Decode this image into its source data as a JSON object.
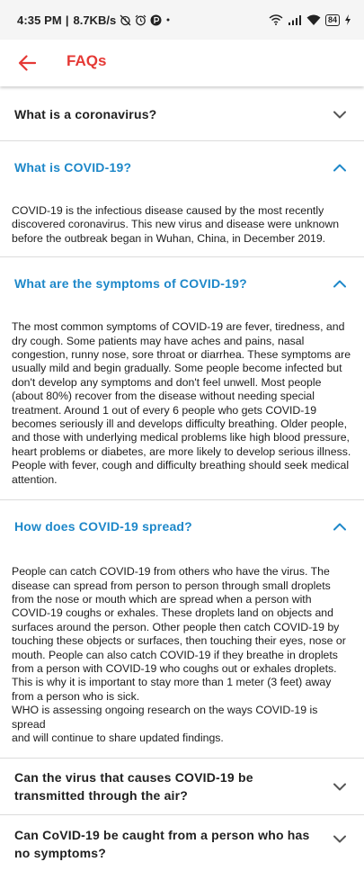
{
  "status_bar": {
    "time": "4:35 PM",
    "speed": "8.7KB/s",
    "battery": "84"
  },
  "app_bar": {
    "title": "FAQs"
  },
  "colors": {
    "accent": "#e53935",
    "expanded_question": "#1e88c9"
  },
  "faqs": [
    {
      "question": "What is a coronavirus?",
      "expanded": false,
      "answer": ""
    },
    {
      "question": "What is COVID-19?",
      "expanded": true,
      "answer": "COVID-19 is the infectious disease caused by the most recently\ndiscovered coronavirus. This new virus and disease were unknown\nbefore the outbreak began in Wuhan, China, in December 2019."
    },
    {
      "question": "What are the symptoms of COVID-19?",
      "expanded": true,
      "answer": "The most common symptoms of COVID-19 are fever, tiredness, and\ndry cough. Some patients may have aches and pains, nasal\ncongestion, runny nose, sore throat or diarrhea. These symptoms are\nusually mild and begin gradually. Some people become infected but\ndon't develop any symptoms and don't feel unwell. Most people\n(about 80%) recover from the disease without needing special\ntreatment. Around 1 out of every 6 people who gets COVID-19\nbecomes seriously ill and develops difficulty breathing. Older people,\nand those with underlying medical problems like high blood pressure,\nheart problems or diabetes, are more likely to develop serious illness.\nPeople with fever, cough and difficulty breathing should seek medical\nattention."
    },
    {
      "question": "How does COVID-19 spread?",
      "expanded": true,
      "answer": "People can catch COVID-19 from others who have the virus. The\ndisease can spread from person to person through small droplets\nfrom the nose or mouth which are spread when a person with\nCOVID-19 coughs or exhales. These droplets land on objects and\nsurfaces around the person. Other people then catch COVID-19 by\ntouching these objects or surfaces, then touching their eyes, nose or\nmouth. People can also catch COVID-19 if they breathe in droplets\nfrom a person with COVID-19 who coughs out or exhales droplets.\nThis is why it is important to stay more than 1 meter (3 feet) away\nfrom a person who is sick.\nWHO is assessing ongoing research on the ways COVID-19 is spread\nand will continue to share updated findings."
    },
    {
      "question": "Can the virus that causes COVID-19 be\ntransmitted through the air?",
      "expanded": false,
      "answer": ""
    },
    {
      "question": "Can CoVID-19 be caught from a person who has\nno symptoms?",
      "expanded": false,
      "answer": ""
    }
  ]
}
